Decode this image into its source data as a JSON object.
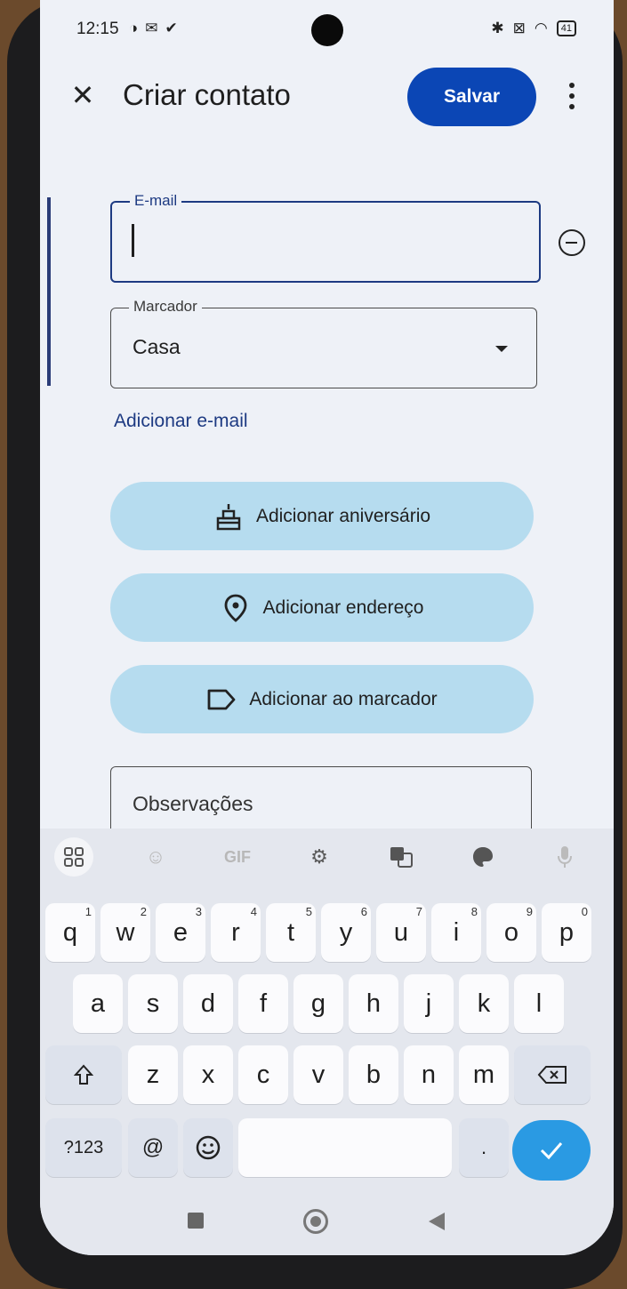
{
  "status_bar": {
    "time": "12:15",
    "left_icons": [
      "circle-half-icon",
      "gmail-icon",
      "check-circle-icon"
    ],
    "right_icons": [
      "bluetooth-icon",
      "sim-icon",
      "wifi-icon"
    ],
    "battery": "41"
  },
  "header": {
    "title": "Criar contato",
    "save_label": "Salvar",
    "accent_color": "#0b46b5"
  },
  "email_field": {
    "label": "E-mail",
    "value": ""
  },
  "label_field": {
    "label": "Marcador",
    "value": "Casa"
  },
  "add_email_link": "Adicionar e-mail",
  "actions": [
    {
      "label": "Adicionar aniversário",
      "icon": "cake-icon"
    },
    {
      "label": "Adicionar endereço",
      "icon": "location-pin-icon"
    },
    {
      "label": "Adicionar ao marcador",
      "icon": "label-icon"
    }
  ],
  "notes": {
    "placeholder": "Observações"
  },
  "keyboard": {
    "toolbar": [
      "apps-grid-icon",
      "sticker-icon",
      "GIF",
      "settings-icon",
      "translate-icon",
      "palette-icon",
      "mic-icon"
    ],
    "row1": [
      {
        "key": "q",
        "hint": "1"
      },
      {
        "key": "w",
        "hint": "2"
      },
      {
        "key": "e",
        "hint": "3"
      },
      {
        "key": "r",
        "hint": "4"
      },
      {
        "key": "t",
        "hint": "5"
      },
      {
        "key": "y",
        "hint": "6"
      },
      {
        "key": "u",
        "hint": "7"
      },
      {
        "key": "i",
        "hint": "8"
      },
      {
        "key": "o",
        "hint": "9"
      },
      {
        "key": "p",
        "hint": "0"
      }
    ],
    "row2": [
      "a",
      "s",
      "d",
      "f",
      "g",
      "h",
      "j",
      "k",
      "l"
    ],
    "row3": [
      "z",
      "x",
      "c",
      "v",
      "b",
      "n",
      "m"
    ],
    "symbols_key": "?123",
    "at_key": "@",
    "period_key": "."
  }
}
